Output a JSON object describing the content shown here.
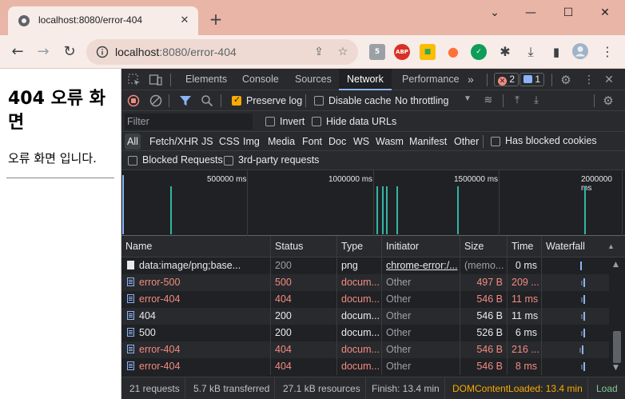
{
  "browser": {
    "tab_title": "localhost:8080/error-404",
    "tab_close": "✕",
    "new_tab": "+",
    "url_host": "localhost",
    "url_path": ":8080/error-404",
    "window": {
      "minimize": "—",
      "maximize": "☐",
      "close": "✕",
      "chevron": "⌄"
    },
    "nav": {
      "back": "←",
      "forward": "→",
      "reload": "↻"
    },
    "extensions": [
      {
        "name": "html5-ext-icon",
        "text": "5",
        "color": "#9aa0a6"
      },
      {
        "name": "adblock-icon",
        "text": "ABP",
        "color": "#d93025"
      },
      {
        "name": "color-picker-ext-icon",
        "text": "■",
        "color": "#f9ab00"
      },
      {
        "name": "rss-ext-icon",
        "text": "●",
        "color": "#ff7139"
      },
      {
        "name": "vuejs-ext-icon",
        "text": "✓",
        "color": "#0f9d58"
      }
    ]
  },
  "page": {
    "heading": "404 오류 화면",
    "body_text": "오류 화면 입니다."
  },
  "devtools": {
    "tabs": [
      "Elements",
      "Console",
      "Sources",
      "Network",
      "Performance"
    ],
    "active_tab": "Network",
    "more_tabs": "»",
    "error_count": "2",
    "message_count": "1",
    "toolbar": {
      "preserve_log": "Preserve log",
      "disable_cache": "Disable cache",
      "throttling": "No throttling"
    },
    "filter": {
      "placeholder": "Filter",
      "invert": "Invert",
      "hide_data_urls": "Hide data URLs"
    },
    "types": [
      "All",
      "Fetch/XHR",
      "JS",
      "CSS",
      "Img",
      "Media",
      "Font",
      "Doc",
      "WS",
      "Wasm",
      "Manifest",
      "Other"
    ],
    "active_type": "All",
    "has_blocked_cookies": "Has blocked cookies",
    "blocked_requests": "Blocked Requests",
    "third_party_requests": "3rd-party requests",
    "overview_ticks": [
      "500000 ms",
      "1000000 ms",
      "1500000 ms",
      "2000000 ms"
    ],
    "columns": [
      "Name",
      "Status",
      "Type",
      "Initiator",
      "Size",
      "Time",
      "Waterfall"
    ],
    "rows": [
      {
        "name": "data:image/png;base...",
        "status": "200",
        "type": "png",
        "initiator": "chrome-error:/...",
        "size": "(memo...",
        "time": "0 ms",
        "error": false,
        "icon": "image"
      },
      {
        "name": "error-500",
        "status": "500",
        "type": "docum...",
        "initiator": "Other",
        "size": "497 B",
        "time": "209 ...",
        "error": true,
        "icon": "doc"
      },
      {
        "name": "error-404",
        "status": "404",
        "type": "docum...",
        "initiator": "Other",
        "size": "546 B",
        "time": "11 ms",
        "error": true,
        "icon": "doc"
      },
      {
        "name": "404",
        "status": "200",
        "type": "docum...",
        "initiator": "Other",
        "size": "546 B",
        "time": "11 ms",
        "error": false,
        "icon": "doc"
      },
      {
        "name": "500",
        "status": "200",
        "type": "docum...",
        "initiator": "Other",
        "size": "526 B",
        "time": "6 ms",
        "error": false,
        "icon": "doc"
      },
      {
        "name": "error-404",
        "status": "404",
        "type": "docum...",
        "initiator": "Other",
        "size": "546 B",
        "time": "216 ...",
        "error": true,
        "icon": "doc"
      },
      {
        "name": "error-404",
        "status": "404",
        "type": "docum...",
        "initiator": "Other",
        "size": "546 B",
        "time": "8 ms",
        "error": true,
        "icon": "doc"
      }
    ],
    "status_bar": {
      "requests": "21 requests",
      "transferred": "5.7 kB transferred",
      "resources": "27.1 kB resources",
      "finish": "Finish: 13.4 min",
      "dom_content_loaded": "DOMContentLoaded: 13.4 min",
      "load": "Load"
    }
  }
}
